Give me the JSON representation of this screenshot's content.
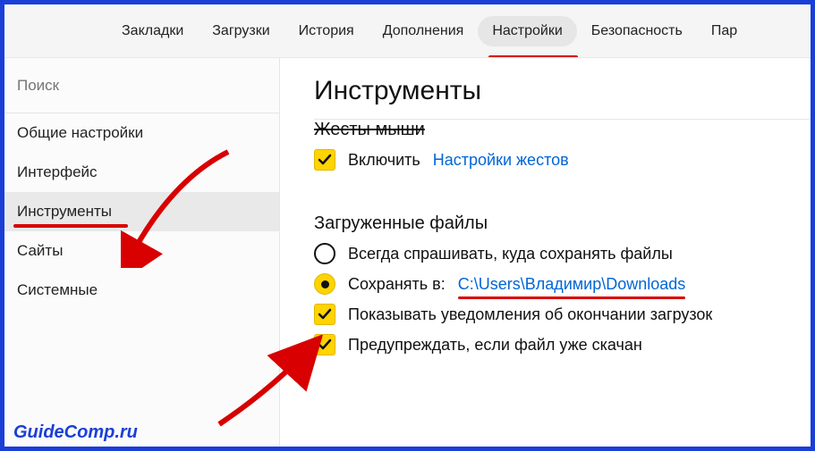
{
  "topbar": {
    "tabs": [
      {
        "label": "Закладки"
      },
      {
        "label": "Загрузки"
      },
      {
        "label": "История"
      },
      {
        "label": "Дополнения"
      },
      {
        "label": "Настройки",
        "active": true
      },
      {
        "label": "Безопасность"
      },
      {
        "label": "Пар"
      }
    ]
  },
  "sidebar": {
    "search_placeholder": "Поиск",
    "items": [
      {
        "label": "Общие настройки"
      },
      {
        "label": "Интерфейс"
      },
      {
        "label": "Инструменты",
        "active": true
      },
      {
        "label": "Сайты"
      },
      {
        "label": "Системные"
      }
    ]
  },
  "main": {
    "title": "Инструменты",
    "mouse_section": {
      "heading": "Жесты мыши",
      "enable_label": "Включить",
      "settings_link": "Настройки жестов"
    },
    "downloads_section": {
      "heading": "Загруженные файлы",
      "always_ask": "Всегда спрашивать, куда сохранять файлы",
      "save_to_label": "Сохранять в:",
      "save_path": "C:\\Users\\Владимир\\Downloads",
      "show_notify": "Показывать уведомления об окончании загрузок",
      "warn_downloaded": "Предупреждать, если файл уже скачан"
    }
  },
  "watermark": "GuideComp.ru"
}
